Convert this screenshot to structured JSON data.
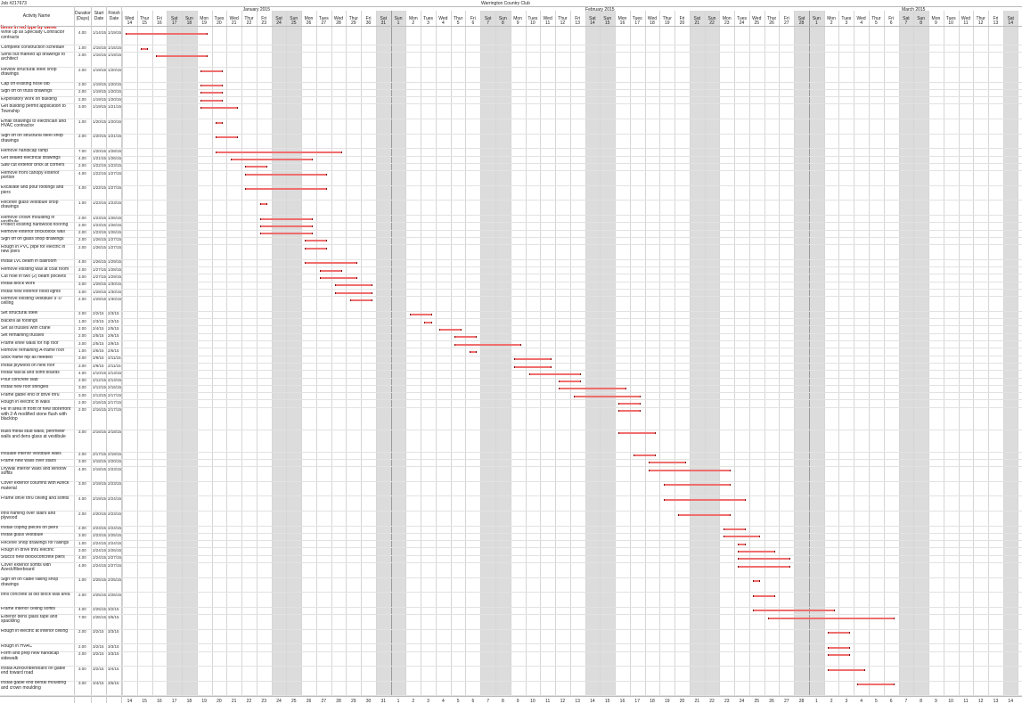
{
  "job": "Job #217673",
  "project": "Warrington Country Club",
  "columns": {
    "activity": "Activity Name",
    "duration": "Duration (Days)",
    "start": "Start Date",
    "finish": "Finish Date"
  },
  "months": [
    "January 2015",
    "February 2015",
    "March 2015"
  ],
  "chart_start_weekday": "Wed",
  "chart_start_day": 14,
  "section_label": "Items in red type by owner",
  "tasks": [
    {
      "name": "Write up all Specialty Contractor contracts",
      "dur": "4.00",
      "start": "1/14/15",
      "finish": "1/19/15",
      "s": 0,
      "e": 5
    },
    {
      "name": "Complete construction schedule",
      "dur": "1.00",
      "start": "1/15/15",
      "finish": "1/15/15",
      "s": 1,
      "e": 1
    },
    {
      "name": "Send out marked up drawings to architect",
      "dur": "2.00",
      "start": "1/16/15",
      "finish": "1/19/15",
      "s": 2,
      "e": 5
    },
    {
      "name": "Review structural steel shop drawings",
      "dur": "2.00",
      "start": "1/19/15",
      "finish": "1/20/15",
      "s": 5,
      "e": 6
    },
    {
      "name": "Cap off existing hose bib",
      "dur": "2.00",
      "start": "1/19/15",
      "finish": "1/20/15",
      "s": 5,
      "e": 6
    },
    {
      "name": "Sign off on truss drawings",
      "dur": "2.00",
      "start": "1/19/15",
      "finish": "1/20/15",
      "s": 5,
      "e": 6
    },
    {
      "name": "Exploratory work on building",
      "dur": "2.00",
      "start": "1/19/15",
      "finish": "1/20/15",
      "s": 5,
      "e": 6
    },
    {
      "name": "Get building permit application to Township",
      "dur": "3.00",
      "start": "1/19/15",
      "finish": "1/21/15",
      "s": 5,
      "e": 7
    },
    {
      "name": "Email drawings to electrician and HVAC contractor",
      "dur": "1.00",
      "start": "1/20/15",
      "finish": "1/20/15",
      "s": 6,
      "e": 6
    },
    {
      "name": "Sign off on structural steel shop drawings",
      "dur": "2.00",
      "start": "1/20/15",
      "finish": "1/21/15",
      "s": 6,
      "e": 7
    },
    {
      "name": "Remove handicap ramp",
      "dur": "7.00",
      "start": "1/20/15",
      "finish": "1/28/15",
      "s": 6,
      "e": 14
    },
    {
      "name": "Get sealed electrical drawings",
      "dur": "4.00",
      "start": "1/21/15",
      "finish": "1/26/15",
      "s": 7,
      "e": 12
    },
    {
      "name": "Saw cut exterior brick at corners",
      "dur": "2.00",
      "start": "1/22/15",
      "finish": "1/23/15",
      "s": 8,
      "e": 9
    },
    {
      "name": "Remove front canopy exterior portion",
      "dur": "4.00",
      "start": "1/22/15",
      "finish": "1/27/15",
      "s": 8,
      "e": 13
    },
    {
      "name": "Excavate and pour footings and piers",
      "dur": "4.00",
      "start": "1/22/15",
      "finish": "1/27/15",
      "s": 8,
      "e": 13
    },
    {
      "name": "Receive glass vestibule shop drawings",
      "dur": "1.00",
      "start": "1/23/15",
      "finish": "1/23/15",
      "s": 9,
      "e": 9
    },
    {
      "name": "Remove crown moulding in vestibule",
      "dur": "2.00",
      "start": "1/23/15",
      "finish": "1/26/15",
      "s": 9,
      "e": 12
    },
    {
      "name": "Protect existing hardwood flooring",
      "dur": "2.00",
      "start": "1/23/15",
      "finish": "1/26/15",
      "s": 9,
      "e": 12
    },
    {
      "name": "Remove exterior brick/block wall",
      "dur": "2.00",
      "start": "1/23/15",
      "finish": "1/26/15",
      "s": 9,
      "e": 12
    },
    {
      "name": "Sign off on glass shop drawings",
      "dur": "2.00",
      "start": "1/26/15",
      "finish": "1/27/15",
      "s": 12,
      "e": 13
    },
    {
      "name": "Rough in PVC pipe for electric in new piers",
      "dur": "2.00",
      "start": "1/26/15",
      "finish": "1/27/15",
      "s": 12,
      "e": 13
    },
    {
      "name": "Install LVL beam in ballroom",
      "dur": "4.00",
      "start": "1/26/15",
      "finish": "1/29/15",
      "s": 12,
      "e": 15
    },
    {
      "name": "Remove existing wall at coat room",
      "dur": "2.00",
      "start": "1/27/15",
      "finish": "1/28/15",
      "s": 13,
      "e": 14
    },
    {
      "name": "Cut hole in two (2) beam pockets",
      "dur": "3.00",
      "start": "1/27/15",
      "finish": "1/29/15",
      "s": 13,
      "e": 15
    },
    {
      "name": "Install block work",
      "dur": "3.00",
      "start": "1/28/15",
      "finish": "1/30/15",
      "s": 14,
      "e": 16
    },
    {
      "name": "Install new exterior flood lights",
      "dur": "3.00",
      "start": "1/28/15",
      "finish": "1/30/15",
      "s": 14,
      "e": 16
    },
    {
      "name": "Remove existing vestibule 9'-0\" ceiling",
      "dur": "2.00",
      "start": "1/29/15",
      "finish": "1/30/15",
      "s": 15,
      "e": 16
    },
    {
      "name": "Set structural steel",
      "dur": "2.00",
      "start": "2/2/15",
      "finish": "2/3/15",
      "s": 19,
      "e": 20
    },
    {
      "name": "Backfill all footings",
      "dur": "1.00",
      "start": "2/3/15",
      "finish": "2/3/15",
      "s": 20,
      "e": 20
    },
    {
      "name": "Set all trusses with crane",
      "dur": "2.00",
      "start": "2/4/15",
      "finish": "2/5/15",
      "s": 21,
      "e": 22
    },
    {
      "name": "Set remaining trusses",
      "dur": "2.00",
      "start": "2/5/15",
      "finish": "2/6/15",
      "s": 22,
      "e": 23
    },
    {
      "name": "Frame knee walls for hip roof",
      "dur": "3.00",
      "start": "2/5/15",
      "finish": "2/9/15",
      "s": 22,
      "e": 26
    },
    {
      "name": "Remove remaining A-frame roof",
      "dur": "1.00",
      "start": "2/6/15",
      "finish": "2/6/15",
      "s": 23,
      "e": 23
    },
    {
      "name": "Stick frame hip as needed",
      "dur": "3.00",
      "start": "2/9/15",
      "finish": "2/11/15",
      "s": 26,
      "e": 28
    },
    {
      "name": "Install plywood on new roof",
      "dur": "3.00",
      "start": "2/9/15",
      "finish": "2/11/15",
      "s": 26,
      "e": 28
    },
    {
      "name": "Install fascia and soffit boards",
      "dur": "4.00",
      "start": "2/10/15",
      "finish": "2/13/15",
      "s": 27,
      "e": 30
    },
    {
      "name": "Pour concrete slab",
      "dur": "2.00",
      "start": "2/12/15",
      "finish": "2/13/15",
      "s": 29,
      "e": 30
    },
    {
      "name": "Install new roof shingles",
      "dur": "3.00",
      "start": "2/12/15",
      "finish": "2/16/15",
      "s": 29,
      "e": 33
    },
    {
      "name": "Frame gable end of drive thru",
      "dur": "3.00",
      "start": "2/13/15",
      "finish": "2/17/15",
      "s": 30,
      "e": 34
    },
    {
      "name": "Rough in electric in walls",
      "dur": "2.00",
      "start": "2/16/15",
      "finish": "2/17/15",
      "s": 33,
      "e": 34
    },
    {
      "name": "Fill in area in front of new storefront with 2-A modified stone flush with blacktop",
      "dur": "2.00",
      "start": "2/16/15",
      "finish": "2/17/15",
      "s": 33,
      "e": 34
    },
    {
      "name": "Build metal stud walls, perimeter walls and dens glass at vestibule",
      "dur": "3.00",
      "start": "2/16/15",
      "finish": "2/18/15",
      "s": 33,
      "e": 35
    },
    {
      "name": "Insulate interior vestibule walls",
      "dur": "2.00",
      "start": "2/17/15",
      "finish": "2/18/15",
      "s": 34,
      "e": 35
    },
    {
      "name": "Frame new walls over stairs",
      "dur": "3.00",
      "start": "2/18/15",
      "finish": "2/20/15",
      "s": 35,
      "e": 37
    },
    {
      "name": "Drywall interior walls and window soffits",
      "dur": "4.00",
      "start": "2/18/15",
      "finish": "2/23/15",
      "s": 35,
      "e": 40
    },
    {
      "name": "Cover exterior columns with Azeck material",
      "dur": "3.00",
      "start": "2/19/15",
      "finish": "2/23/15",
      "s": 36,
      "e": 40
    },
    {
      "name": "Frame drive thru ceiling and soffits",
      "dur": "4.00",
      "start": "2/19/15",
      "finish": "2/24/15",
      "s": 36,
      "e": 41
    },
    {
      "name": "Infill framing over stairs and plywood",
      "dur": "2.00",
      "start": "2/20/15",
      "finish": "2/23/15",
      "s": 37,
      "e": 40
    },
    {
      "name": "Install coping pieces on piers",
      "dur": "2.00",
      "start": "2/23/15",
      "finish": "2/24/15",
      "s": 40,
      "e": 41
    },
    {
      "name": "Install glass vestibule",
      "dur": "3.00",
      "start": "2/23/15",
      "finish": "2/25/15",
      "s": 40,
      "e": 42
    },
    {
      "name": "Receive shop drawings for railings",
      "dur": "1.00",
      "start": "2/24/15",
      "finish": "2/24/15",
      "s": 41,
      "e": 41
    },
    {
      "name": "Rough in drive thru electric",
      "dur": "3.00",
      "start": "2/24/15",
      "finish": "2/26/15",
      "s": 41,
      "e": 43
    },
    {
      "name": "Stucco new block/concrete piers",
      "dur": "4.00",
      "start": "2/24/15",
      "finish": "2/27/15",
      "s": 41,
      "e": 44
    },
    {
      "name": "Cover exterior soffits with Azeck/fiberboard",
      "dur": "4.00",
      "start": "2/24/15",
      "finish": "2/27/15",
      "s": 41,
      "e": 44
    },
    {
      "name": "Sign off on cable railing shop drawings",
      "dur": "1.00",
      "start": "2/25/15",
      "finish": "2/25/15",
      "s": 42,
      "e": 42
    },
    {
      "name": "Infill concrete at old block wall area",
      "dur": "2.00",
      "start": "2/25/15",
      "finish": "2/26/15",
      "s": 42,
      "e": 43
    },
    {
      "name": "Frame interior ceiling soffits",
      "dur": "4.00",
      "start": "2/25/15",
      "finish": "3/2/15",
      "s": 42,
      "e": 47
    },
    {
      "name": "Exterior dens glass tape and spackling",
      "dur": "7.00",
      "start": "2/26/15",
      "finish": "3/6/15",
      "s": 43,
      "e": 51
    },
    {
      "name": "Rough in electric at interior ceiling",
      "dur": "2.00",
      "start": "3/2/15",
      "finish": "3/3/15",
      "s": 47,
      "e": 48
    },
    {
      "name": "Rough in HVAC",
      "dur": "2.00",
      "start": "3/2/15",
      "finish": "3/3/15",
      "s": 47,
      "e": 48
    },
    {
      "name": "Form and prep new handicap sidewalk",
      "dur": "2.00",
      "start": "3/2/15",
      "finish": "3/3/15",
      "s": 47,
      "e": 48
    },
    {
      "name": "Install Azeck/fiberboard on gable end toward road",
      "dur": "3.00",
      "start": "3/2/15",
      "finish": "3/4/15",
      "s": 47,
      "e": 49
    },
    {
      "name": "Install gable end dental moulding and crown moulding",
      "dur": "3.00",
      "start": "3/4/15",
      "finish": "3/6/15",
      "s": 49,
      "e": 51
    }
  ],
  "weekdays": [
    "Wed",
    "Thur",
    "Fri",
    "Sat",
    "Sun",
    "Mon",
    "Tues"
  ],
  "colors": {
    "bar": "#ef6e6e",
    "bar_end": "#7a1010",
    "weekend": "#dcdcdc",
    "owner_text": "#d40000"
  }
}
